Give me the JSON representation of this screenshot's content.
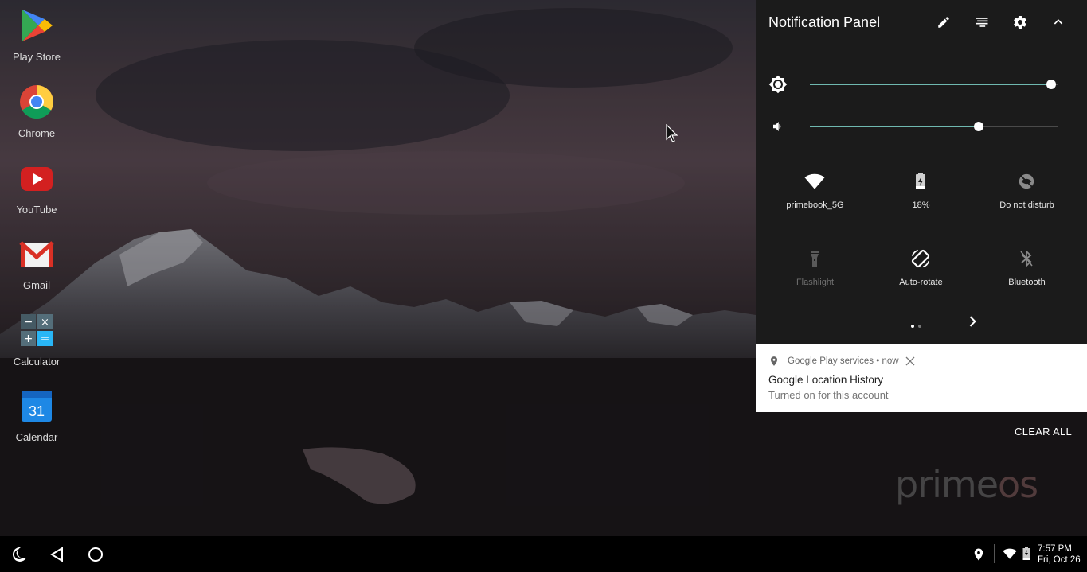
{
  "desktop": {
    "apps": [
      {
        "label": "Play Store",
        "icon": "play-store-icon"
      },
      {
        "label": "Chrome",
        "icon": "chrome-icon"
      },
      {
        "label": "YouTube",
        "icon": "youtube-icon"
      },
      {
        "label": "Gmail",
        "icon": "gmail-icon"
      },
      {
        "label": "Calculator",
        "icon": "calculator-icon"
      },
      {
        "label": "Calendar",
        "icon": "calendar-icon",
        "badge": "31"
      }
    ]
  },
  "panel": {
    "title": "Notification Panel",
    "header_icons": [
      "edit-icon",
      "sort-icon",
      "gear-icon",
      "chevron-up-icon"
    ],
    "brightness": {
      "icon": "brightness-icon",
      "level": 0.97
    },
    "volume": {
      "icon": "volume-icon",
      "level": 0.68
    },
    "tiles": [
      {
        "label": "primebook_5G",
        "icon": "wifi-icon",
        "state": "on"
      },
      {
        "label": "18%",
        "icon": "battery-icon",
        "state": "on"
      },
      {
        "label": "Do not disturb",
        "icon": "dnd-icon",
        "state": "on"
      },
      {
        "label": "Flashlight",
        "icon": "flashlight-icon",
        "state": "off"
      },
      {
        "label": "Auto-rotate",
        "icon": "auto-rotate-icon",
        "state": "on"
      },
      {
        "label": "Bluetooth",
        "icon": "bluetooth-icon",
        "state": "on"
      }
    ],
    "pages": {
      "count": 2,
      "current": 1
    },
    "accent": "#6fb8b0"
  },
  "notification": {
    "app": "Google Play services",
    "separator": "•",
    "time": "now",
    "title": "Google Location History",
    "text": "Turned on for this account"
  },
  "clear_all": "CLEAR ALL",
  "watermark": {
    "prime": "prime",
    "os": "os"
  },
  "taskbar": {
    "time": "7:57 PM",
    "date": "Fri, Oct 26"
  }
}
